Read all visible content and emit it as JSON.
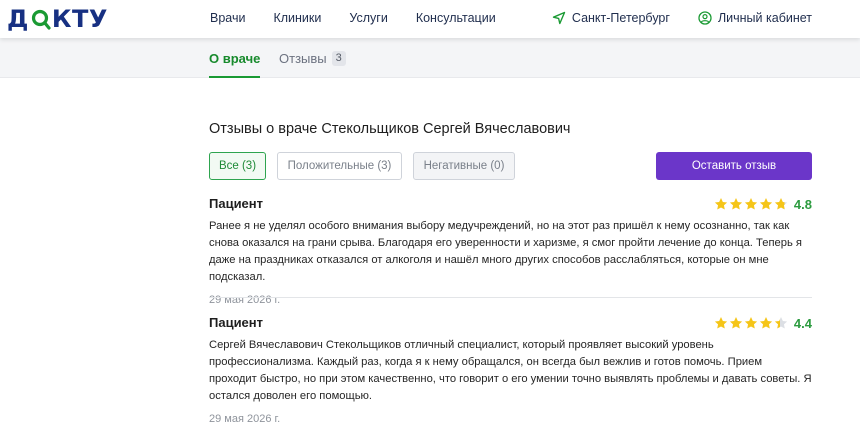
{
  "colors": {
    "brand_navy": "#173082",
    "brand_green": "#1a9a33",
    "accent_purple": "#6b36c9",
    "star_yellow": "#f5c518",
    "rating_green": "#2c9b3f"
  },
  "header": {
    "logo": "ДОКТУ",
    "nav": [
      "Врачи",
      "Клиники",
      "Услуги",
      "Консультации"
    ],
    "city": "Санкт-Петербург",
    "city_icon": "location-arrow-icon",
    "account": "Личный кабинет",
    "account_icon": "user-circle-icon"
  },
  "tabs": {
    "about": "О враче",
    "reviews": "Отзывы",
    "reviews_count": "3"
  },
  "title": "Отзывы о враче Стекольщиков Сергей Вячеславович",
  "filters": {
    "all": "Все (3)",
    "positive": "Положительные (3)",
    "negative": "Негативные (0)"
  },
  "leave_review": "Оставить отзыв",
  "reviews": [
    {
      "author": "Пациент",
      "rating": 4.8,
      "rating_text": "4.8",
      "text": "Ранее я не уделял особого внимания выбору медучреждений, но на этот раз пришёл к нему осознанно, так как снова оказался на грани срыва. Благодаря его уверенности и харизме, я смог пройти лечение до конца. Теперь я даже на праздниках отказался от алкоголя и нашёл много других способов расслабляться, которые он мне подсказал.",
      "date": "29 мая 2026 г."
    },
    {
      "author": "Пациент",
      "rating": 4.4,
      "rating_text": "4.4",
      "text": "Сергей Вячеславович Стекольщиков отличный специалист, который проявляет высокий уровень профессионализма. Каждый раз, когда я к нему обращался, он всегда был вежлив и готов помочь. Прием проходит быстро, но при этом качественно, что говорит о его умении точно выявлять проблемы и давать советы. Я остался доволен его помощью.",
      "date": "29 мая 2026 г."
    }
  ]
}
